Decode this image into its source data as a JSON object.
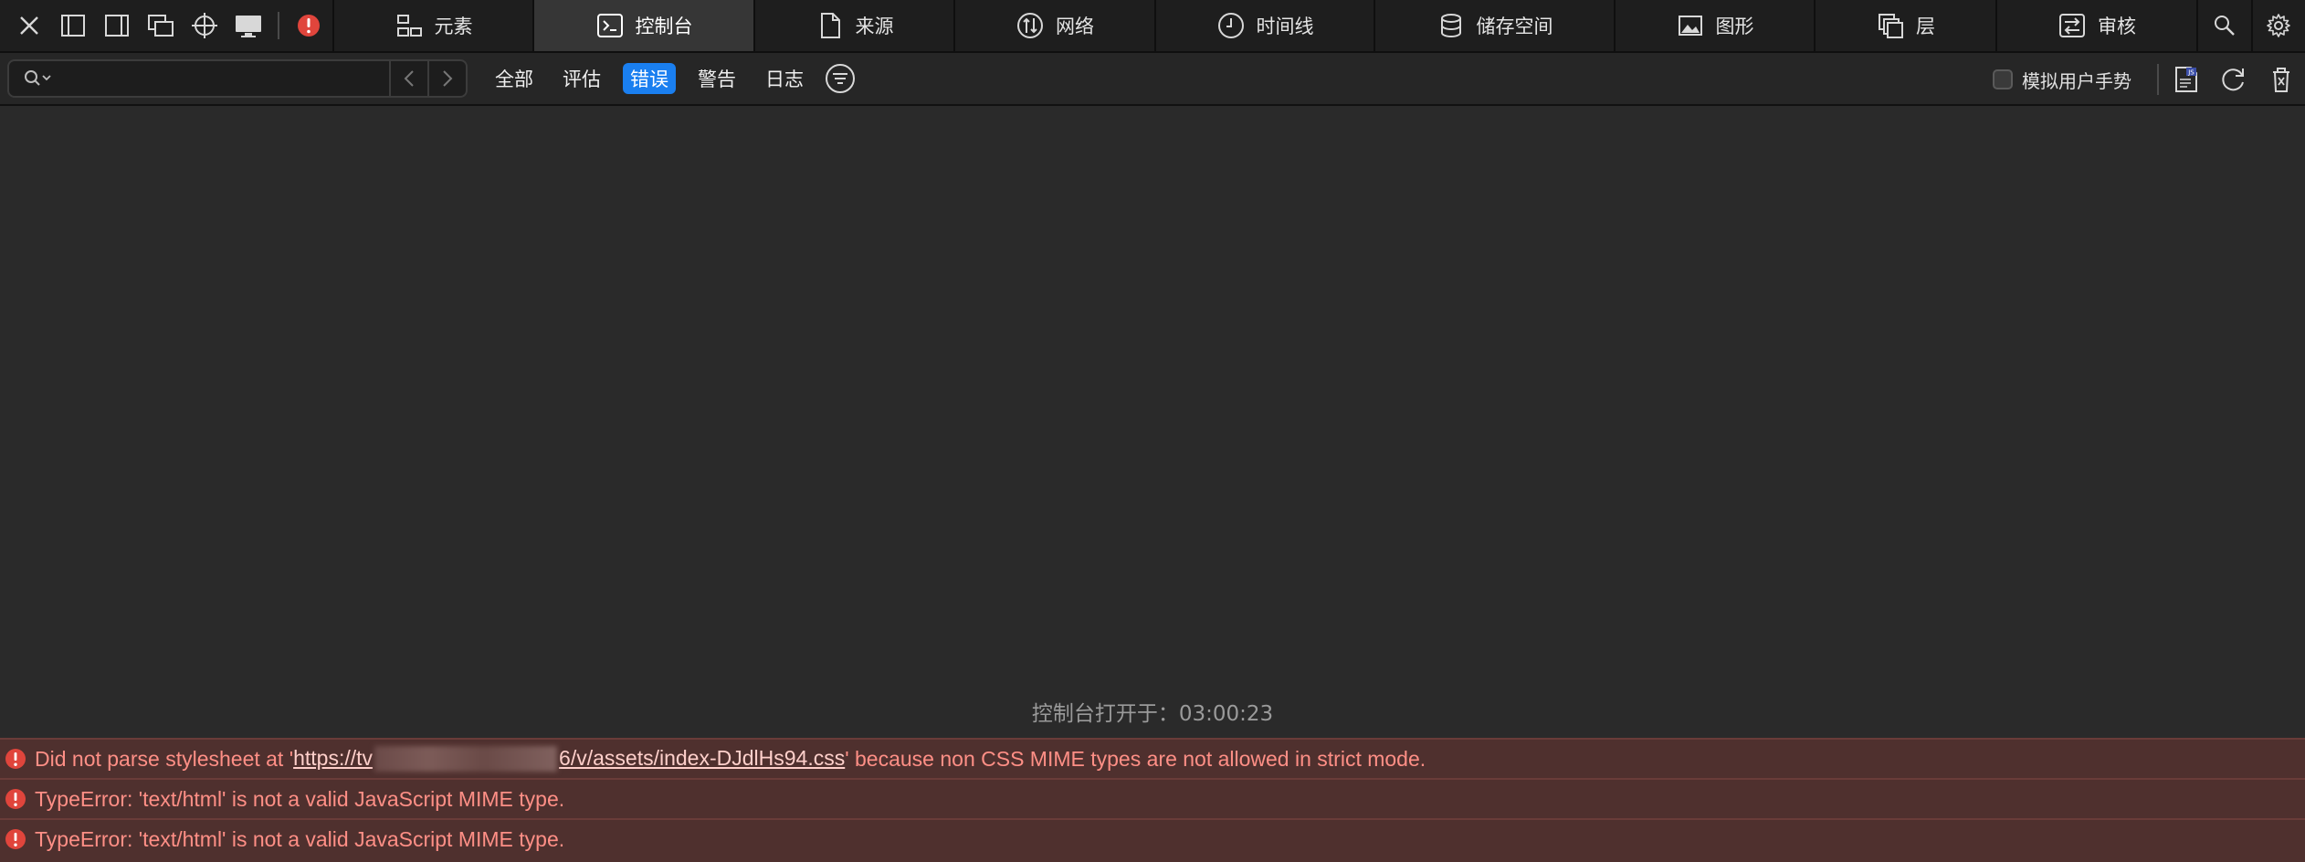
{
  "tabs": [
    {
      "id": "elements",
      "label": "元素",
      "icon": "elements-icon"
    },
    {
      "id": "console",
      "label": "控制台",
      "icon": "console-icon"
    },
    {
      "id": "sources",
      "label": "来源",
      "icon": "sources-icon"
    },
    {
      "id": "network",
      "label": "网络",
      "icon": "network-icon"
    },
    {
      "id": "timeline",
      "label": "时间线",
      "icon": "timeline-icon"
    },
    {
      "id": "storage",
      "label": "储存空间",
      "icon": "storage-icon"
    },
    {
      "id": "graphics",
      "label": "图形",
      "icon": "graphics-icon"
    },
    {
      "id": "layers",
      "label": "层",
      "icon": "layers-icon"
    },
    {
      "id": "audit",
      "label": "审核",
      "icon": "audit-icon"
    }
  ],
  "active_tab": "console",
  "filterbar": {
    "search_value": "",
    "levels": [
      {
        "label": "全部",
        "selected": false
      },
      {
        "label": "评估",
        "selected": false
      },
      {
        "label": "错误",
        "selected": true
      },
      {
        "label": "警告",
        "selected": false
      },
      {
        "label": "日志",
        "selected": false
      }
    ],
    "gesture_label": "模拟用户手势",
    "gesture_checked": false
  },
  "console": {
    "opened_at_label": "控制台打开于：",
    "opened_at_time": "03:00:23"
  },
  "messages": [
    {
      "level": "error",
      "prefix": "Did not parse stylesheet at '",
      "url_start": "https://tv",
      "url_end": "6/v/assets/index-DJdlHs94.css",
      "suffix": "' because non CSS MIME types are not allowed in strict mode."
    },
    {
      "level": "error",
      "text": "TypeError: 'text/html' is not a valid JavaScript MIME type."
    },
    {
      "level": "error",
      "text": "TypeError: 'text/html' is not a valid JavaScript MIME type."
    }
  ],
  "colors": {
    "accent": "#1a7ff0",
    "error_text": "#ff8f86",
    "error_bg": "#4f302e",
    "error_icon": "#e0453c"
  }
}
